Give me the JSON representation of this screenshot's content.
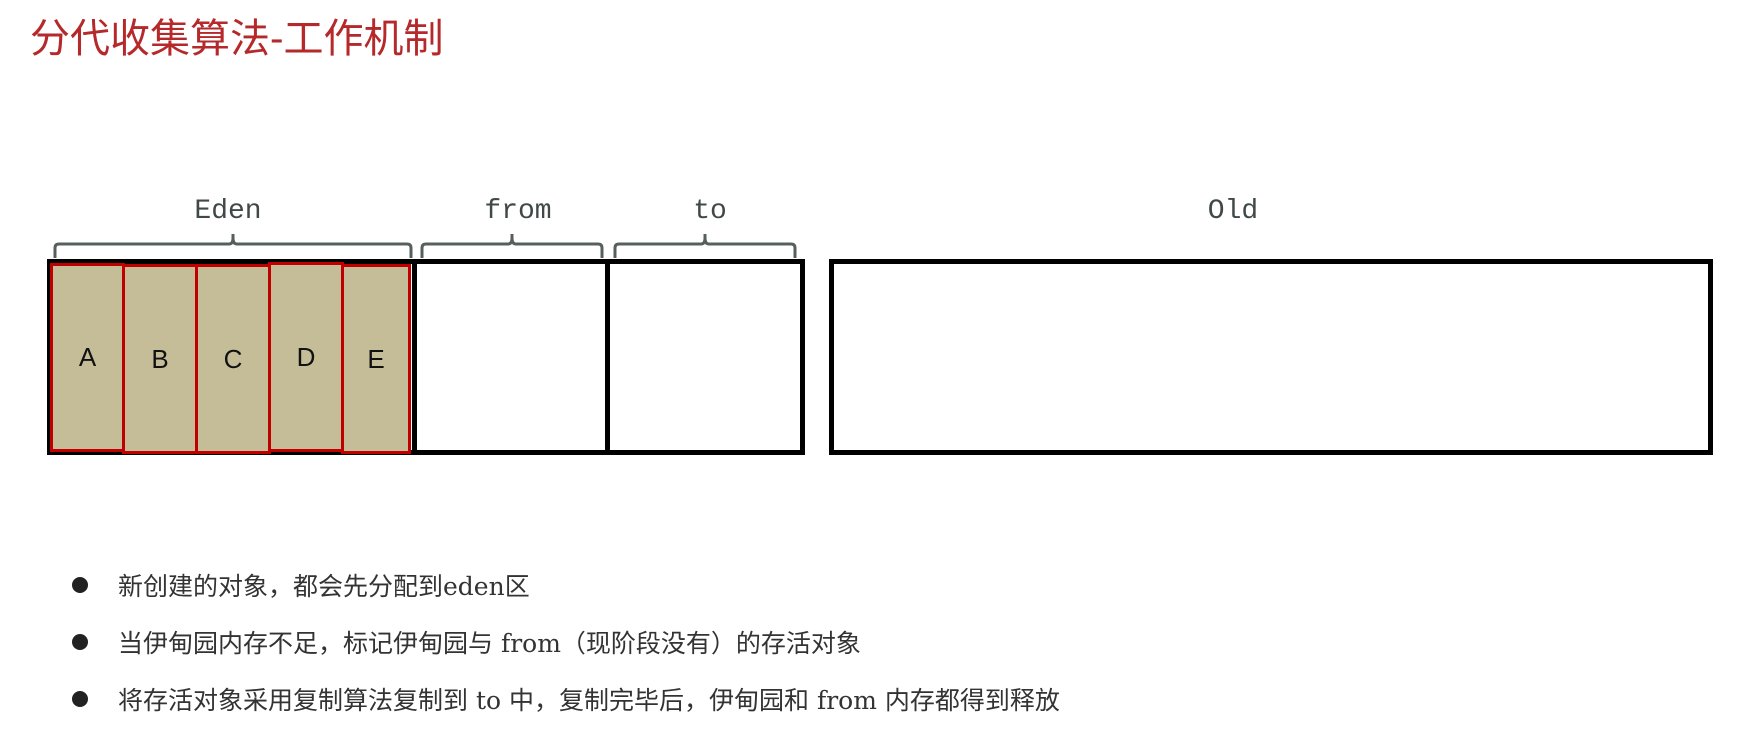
{
  "title": "分代收集算法-工作机制",
  "regions": {
    "eden": {
      "label": "Eden"
    },
    "from": {
      "label": "from"
    },
    "to": {
      "label": "to"
    },
    "old": {
      "label": "Old"
    }
  },
  "eden_objects": [
    "A",
    "B",
    "C",
    "D",
    "E"
  ],
  "colors": {
    "title": "#b5292b",
    "object_fill": "#c4bd98",
    "object_border": "#c00000",
    "region_border": "#000000",
    "bracket": "#55605e"
  },
  "bullets": [
    "新创建的对象，都会先分配到eden区",
    "当伊甸园内存不足，标记伊甸园与 from（现阶段没有）的存活对象",
    "将存活对象采用复制算法复制到 to 中，复制完毕后，伊甸园和 from 内存都得到释放"
  ]
}
